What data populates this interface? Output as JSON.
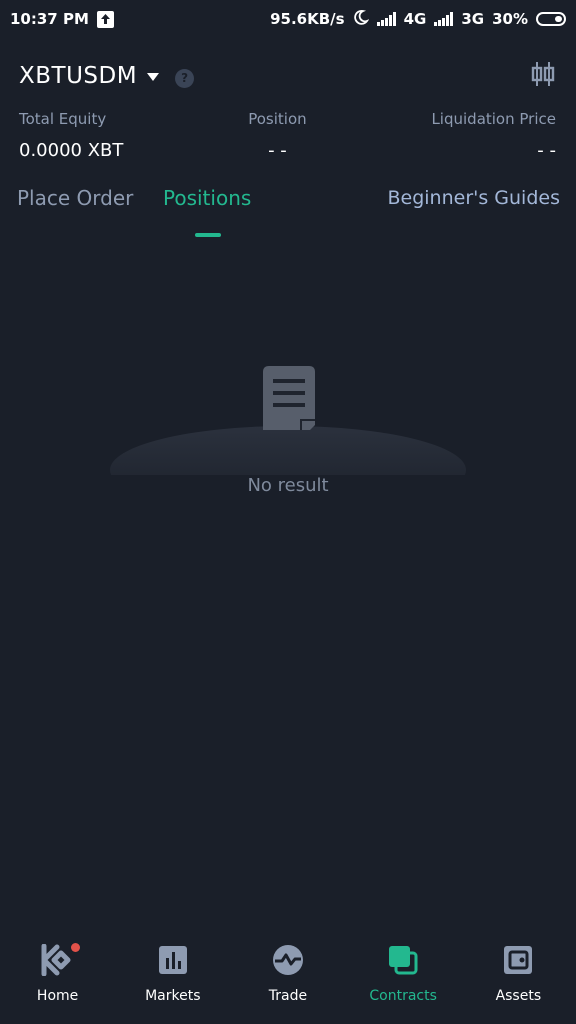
{
  "status_bar": {
    "time": "10:37 PM",
    "net_speed": "95.6KB/s",
    "net1": "4G",
    "net2": "3G",
    "battery": "30%"
  },
  "header": {
    "pair": "XBTUSDM",
    "help": "?"
  },
  "stats": {
    "total_equity_label": "Total Equity",
    "total_equity_value": "0.0000 XBT",
    "position_label": "Position",
    "position_value": "- -",
    "liq_label": "Liquidation Price",
    "liq_value": "- -"
  },
  "tabs": {
    "place_order": "Place Order",
    "positions": "Positions",
    "guides": "Beginner's Guides",
    "active": "Positions"
  },
  "empty_state": {
    "message": "No result"
  },
  "bottom_nav": {
    "items": [
      {
        "label": "Home",
        "icon": "kucoin-logo-icon"
      },
      {
        "label": "Markets",
        "icon": "bar-chart-icon"
      },
      {
        "label": "Trade",
        "icon": "trade-wave-icon"
      },
      {
        "label": "Contracts",
        "icon": "contracts-icon"
      },
      {
        "label": "Assets",
        "icon": "wallet-icon"
      }
    ],
    "active": "Contracts"
  },
  "colors": {
    "background": "#1a1f29",
    "accent": "#23b88f",
    "muted": "#8e9bb1",
    "notification": "#e2524a"
  }
}
